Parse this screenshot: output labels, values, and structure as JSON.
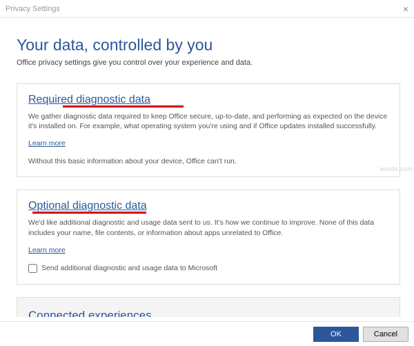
{
  "window": {
    "title": "Privacy Settings",
    "close_glyph": "×"
  },
  "header": {
    "title": "Your data, controlled by you",
    "subtitle": "Office privacy settings give you control over your experience and data."
  },
  "required": {
    "heading": "Required diagnostic data",
    "desc": "We gather diagnostic data required to keep Office secure, up-to-date, and performing as expected on the device it's installed on. For example, what operating system you're using and if Office updates installed successfully.",
    "learn": "Learn more",
    "note": "Without this basic information about your device, Office can't run."
  },
  "optional": {
    "heading": "Optional diagnostic data",
    "desc": "We'd like additional diagnostic and usage data sent to us. It's how we continue to improve. None of this data includes your name, file contents, or information about apps unrelated to Office.",
    "learn": "Learn more",
    "checkbox_label": "Send additional diagnostic and usage data to Microsoft"
  },
  "connected": {
    "heading": "Connected experiences"
  },
  "footer": {
    "ok": "OK",
    "cancel": "Cancel"
  },
  "watermark": "wsxdn.com"
}
